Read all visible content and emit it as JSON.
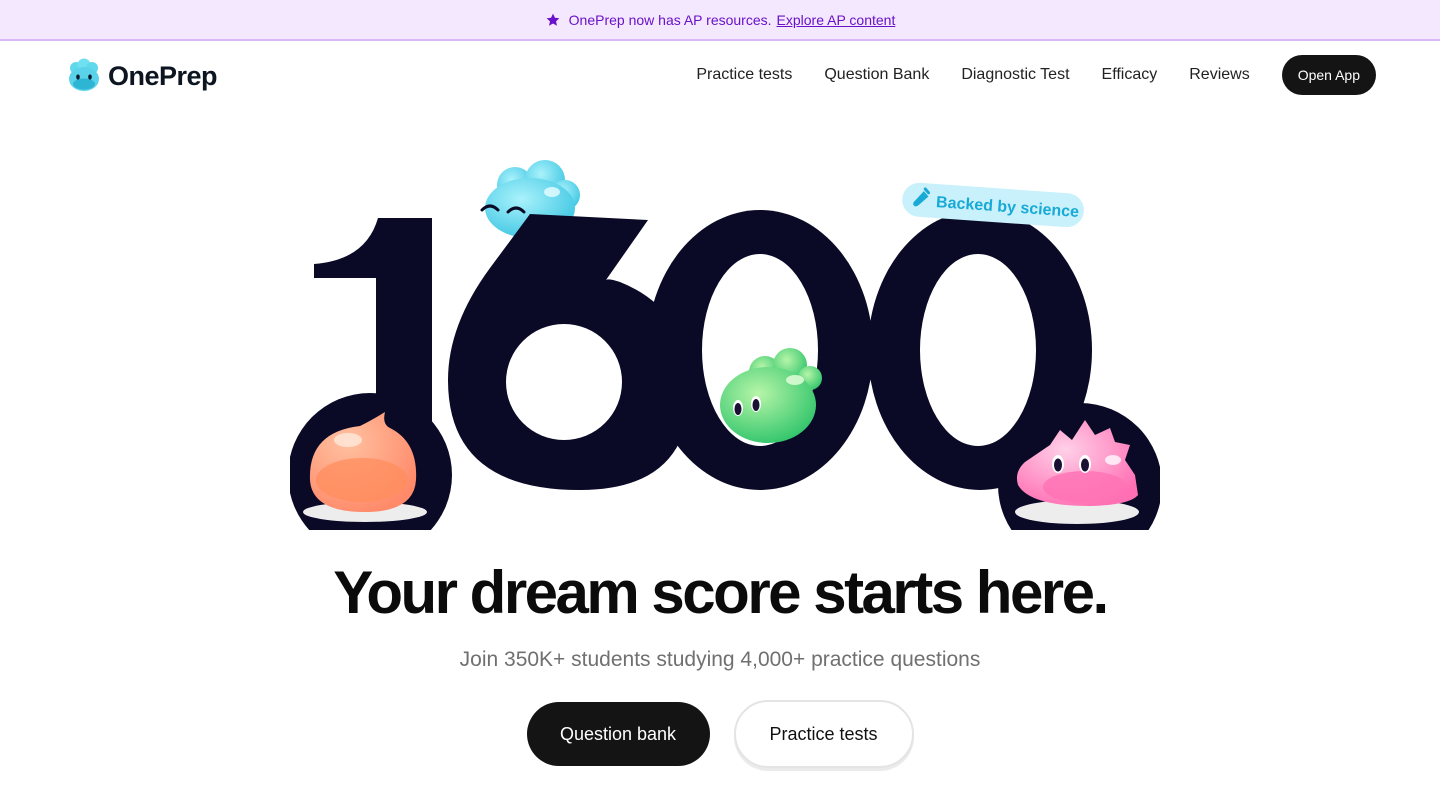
{
  "announcement": {
    "text": "OnePrep now has AP resources.",
    "link": "Explore AP content",
    "icon": "star-icon"
  },
  "header": {
    "logo_text": "OnePrep",
    "nav": [
      {
        "label": "Practice tests"
      },
      {
        "label": "Question Bank"
      },
      {
        "label": "Diagnostic Test"
      },
      {
        "label": "Efficacy"
      },
      {
        "label": "Reviews"
      }
    ],
    "open_app": "Open App"
  },
  "hero": {
    "score": "1600",
    "badge": "Backed by science",
    "badge_icon": "test-tube-icon",
    "headline": "Your dream score starts here.",
    "subheadline": "Join 350K+ students studying 4,000+ practice questions",
    "primary_button": "Question bank",
    "secondary_button": "Practice tests"
  },
  "colors": {
    "accent_purple": "#6a12c9",
    "announce_bg": "#f3e8fd",
    "score_navy": "#0a0a26",
    "mascot_blue": "#5fd8ec",
    "mascot_green": "#56d874",
    "mascot_orange": "#ff9f7c",
    "mascot_pink": "#ff8fc4",
    "badge_bg": "#c9f1fb",
    "badge_text": "#18a9d6"
  }
}
